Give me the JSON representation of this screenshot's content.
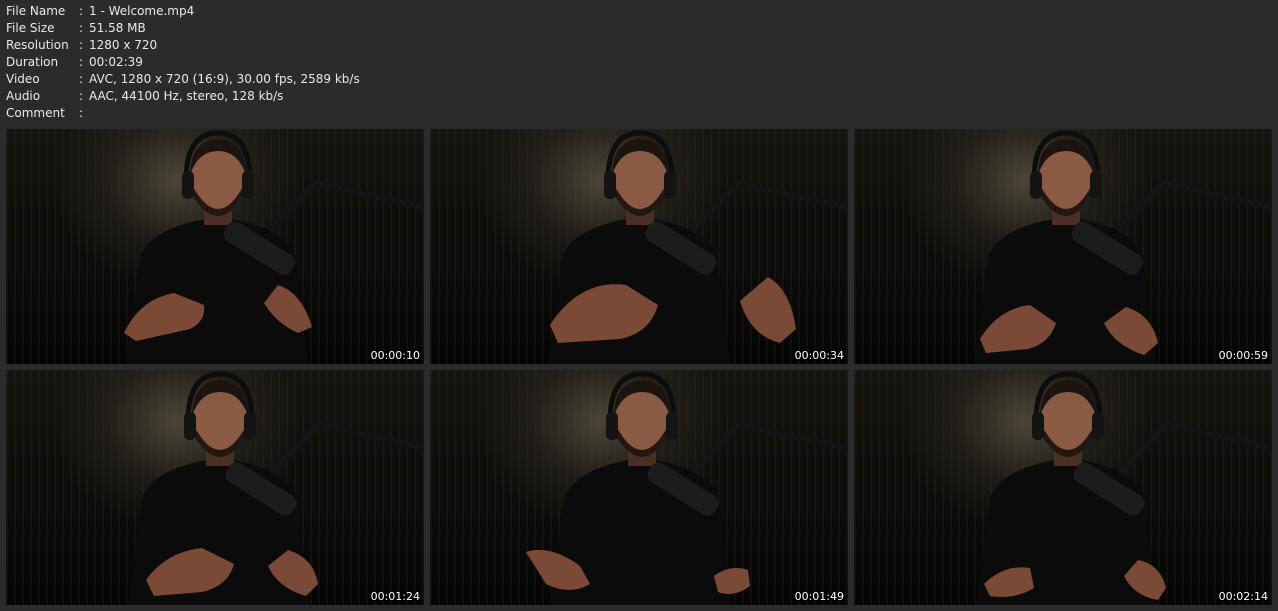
{
  "info": [
    {
      "key": "File Name",
      "sep": ":",
      "value": "1 - Welcome.mp4"
    },
    {
      "key": "File Size",
      "sep": ":",
      "value": "51.58 MB"
    },
    {
      "key": "Resolution",
      "sep": ":",
      "value": "1280 x 720"
    },
    {
      "key": "Duration",
      "sep": ":",
      "value": "00:02:39"
    },
    {
      "key": "Video",
      "sep": ":",
      "value": "AVC, 1280 x 720 (16:9), 30.00 fps, 2589 kb/s"
    },
    {
      "key": "Audio",
      "sep": ":",
      "value": "AAC, 44100 Hz, stereo, 128 kb/s"
    },
    {
      "key": "Comment",
      "sep": ":",
      "value": ""
    }
  ],
  "thumbnails": [
    {
      "time": "00:00:10"
    },
    {
      "time": "00:00:34"
    },
    {
      "time": "00:00:59"
    },
    {
      "time": "00:01:24"
    },
    {
      "time": "00:01:49"
    },
    {
      "time": "00:02:14"
    }
  ],
  "colors": {
    "background": "#2b2b2b",
    "text": "#e9e9e9",
    "timestamp": "#ffffff"
  }
}
